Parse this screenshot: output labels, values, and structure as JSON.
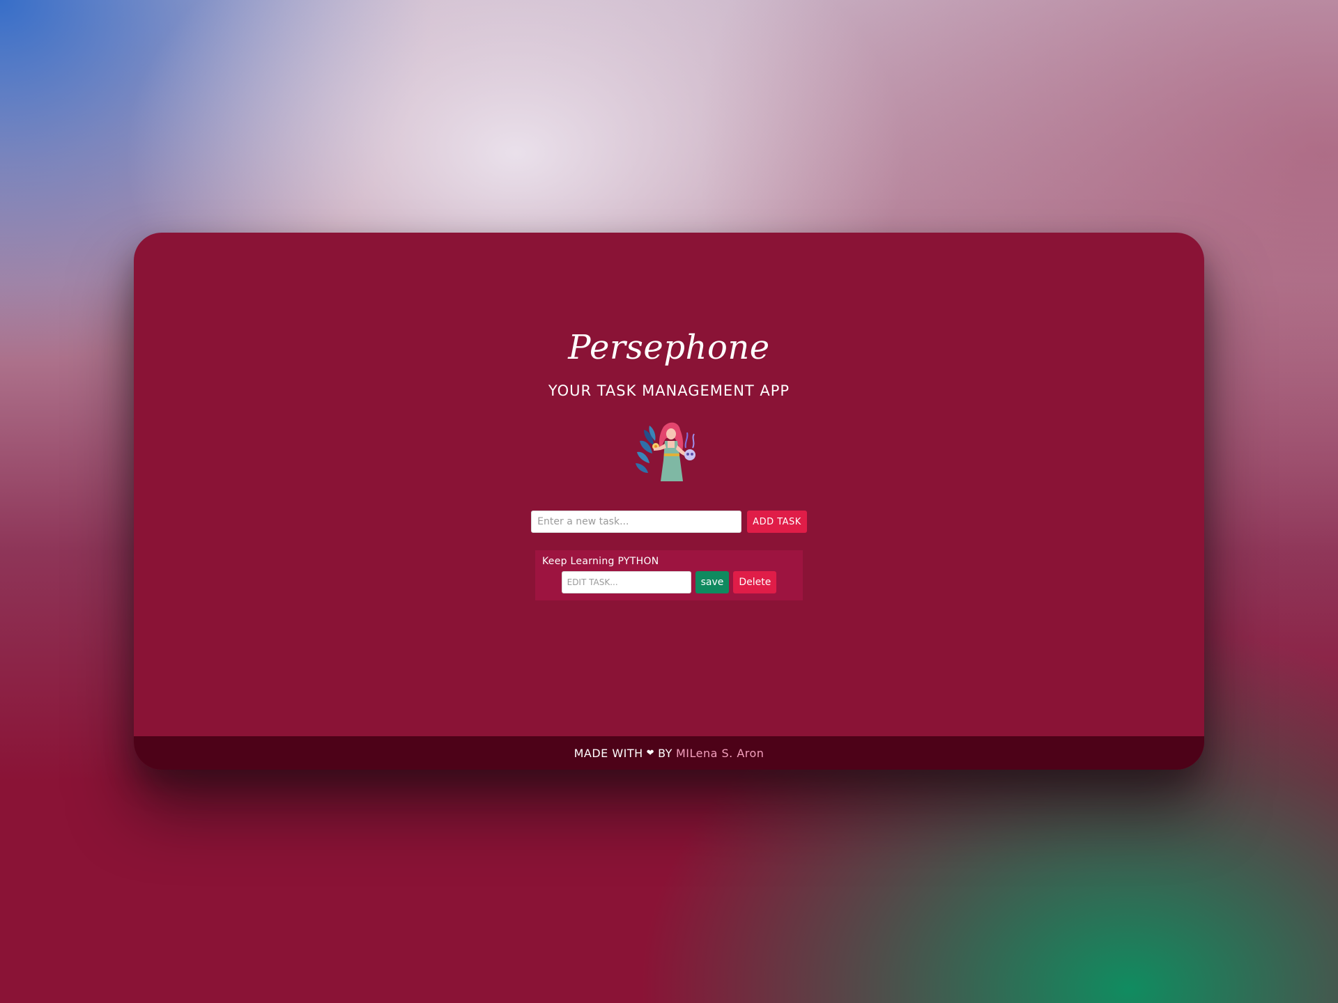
{
  "app": {
    "title": "Persephone",
    "subtitle": "YOUR TASK MANAGEMENT APP"
  },
  "illustration": {
    "icon": "persephone-goddess-illustration"
  },
  "new_task": {
    "placeholder": "Enter a new task...",
    "value": "",
    "add_label": "ADD TASK"
  },
  "tasks": [
    {
      "text": "Keep Learning PYTHON",
      "edit_placeholder": "EDIT TASK...",
      "save_label": "save",
      "delete_label": "Delete"
    }
  ],
  "footer": {
    "made_with": "MADE WITH",
    "heart_icon": "heart-icon",
    "heart": "❤",
    "by": "BY",
    "author": "MILena S. Aron"
  },
  "colors": {
    "card": "#8a1336",
    "task_item": "#9d1440",
    "footer": "#4d0218",
    "primary_button": "#e01d48",
    "save_button": "#0f8a5f",
    "author_link": "#f3a0bd"
  }
}
